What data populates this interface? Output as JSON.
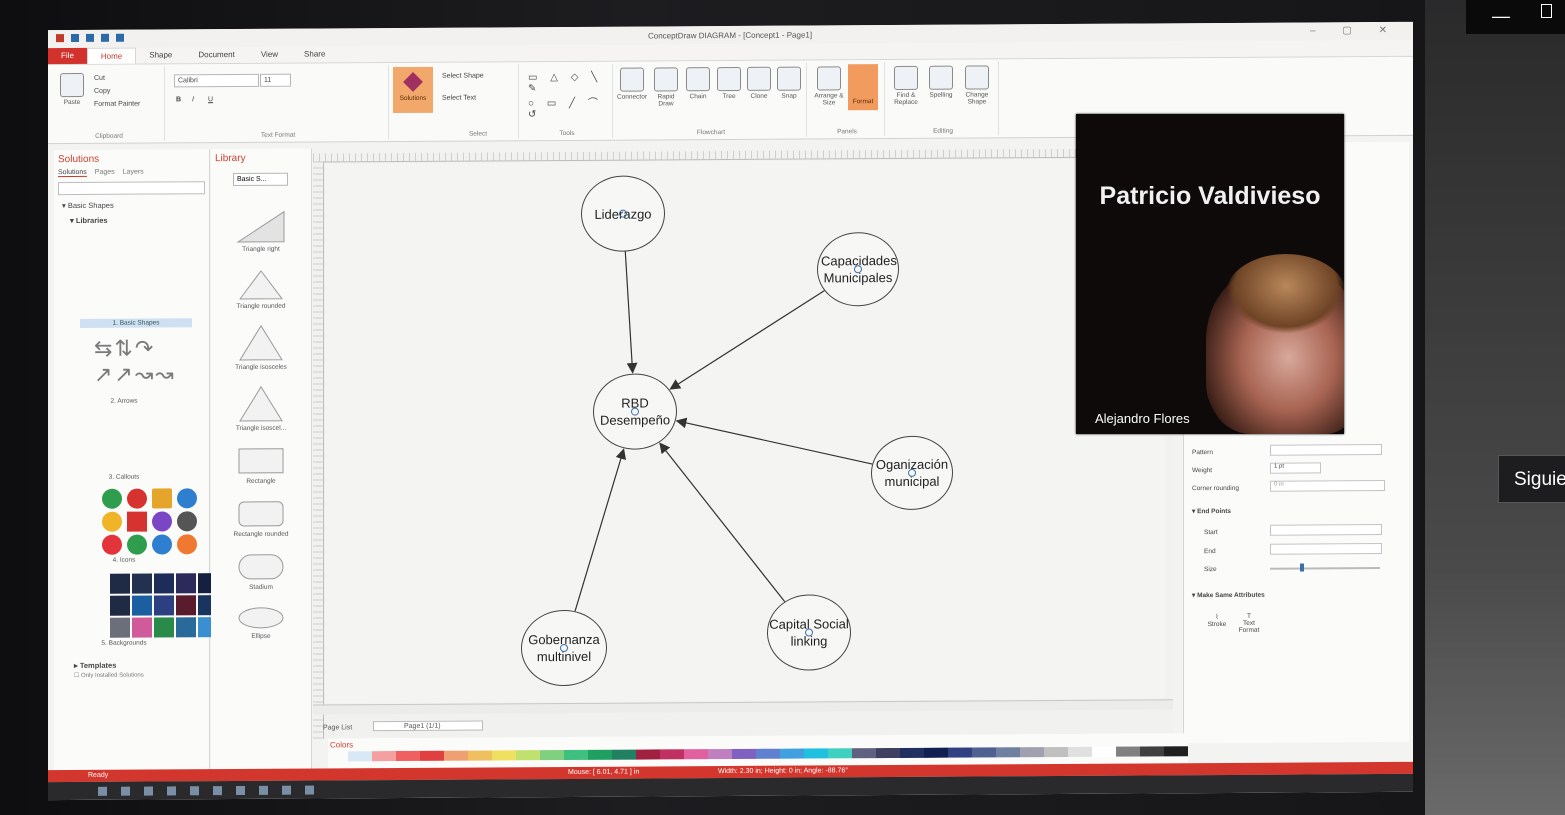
{
  "app": {
    "title": "ConceptDraw DIAGRAM - [Concept1 - Page1]"
  },
  "ribbon_tabs": [
    "File",
    "Home",
    "Shape",
    "Document",
    "View",
    "Share"
  ],
  "ribbon": {
    "clipboard": {
      "paste": "Paste",
      "cut": "Cut",
      "copy": "Copy",
      "format_painter": "Format Painter",
      "label": "Clipboard"
    },
    "text_format": {
      "font": "Calibri",
      "size": "11",
      "label": "Text Format"
    },
    "solutions": "Solutions",
    "select": {
      "select_shape": "Select Shape",
      "select_text": "Select Text",
      "label": "Select"
    },
    "tools_label": "Tools",
    "flowchart": {
      "connector": "Connector",
      "rapid_draw": "Rapid Draw",
      "chain": "Chain",
      "tree": "Tree",
      "clone": "Clone",
      "snap": "Snap",
      "label": "Flowchart"
    },
    "panels": {
      "arrange": "Arrange & Size",
      "format": "Format",
      "label": "Panels"
    },
    "editing": {
      "find": "Find & Replace",
      "spelling": "Spelling",
      "change_shape": "Change Shape",
      "label": "Editing"
    }
  },
  "solutions_panel": {
    "title": "Solutions",
    "tabs": [
      "Solutions",
      "Pages",
      "Layers"
    ],
    "tree": [
      "Basic Shapes",
      "Libraries"
    ],
    "libraries": [
      "1. Basic Shapes",
      "2. Arrows",
      "3. Callouts",
      "4. Icons",
      "5. Backgrounds"
    ],
    "templates": "Templates",
    "only_installed": "Only Installed Solutions"
  },
  "library_panel": {
    "title": "Library",
    "selector": "Basic S...",
    "shapes": [
      "Triangle right",
      "Triangle rounded",
      "Triangle isosceles",
      "Triangle isoscel...",
      "Rectangle",
      "Rectangle rounded",
      "Stadium",
      "Ellipse"
    ]
  },
  "diagram": {
    "nodes": [
      {
        "id": "liderazgo",
        "text": "Liderazgo"
      },
      {
        "id": "capacidades",
        "text": "Capacidades Municipales"
      },
      {
        "id": "rbd",
        "text": "RBD Desempeño"
      },
      {
        "id": "organizacion",
        "text": "Oganización municipal"
      },
      {
        "id": "gobernanza",
        "text": "Gobernanza multinivel"
      },
      {
        "id": "capital",
        "text": "Capital Social linking"
      }
    ],
    "edges": [
      {
        "from": "liderazgo",
        "to": "rbd"
      },
      {
        "from": "capacidades",
        "to": "rbd"
      },
      {
        "from": "organizacion",
        "to": "rbd"
      },
      {
        "from": "gobernanza",
        "to": "rbd"
      },
      {
        "from": "capital",
        "to": "rbd"
      }
    ]
  },
  "page_list": {
    "label": "Page List",
    "current": "Page1 (1/1)"
  },
  "colors_label": "Colors",
  "status": {
    "ready": "Ready",
    "mouse": "Mouse: [ 6.01, 4.71 ] in",
    "size": "Width: 2.30 in; Height: 0 in; Angle: -88.76°"
  },
  "properties_panel": {
    "pattern": "Pattern",
    "weight": "Weight",
    "weight_value": "1 pt",
    "corner_rounding": "Corner rounding",
    "corner_rounding_value": "0 in",
    "end_points": "End Points",
    "start": "Start",
    "end": "End",
    "size": "Size",
    "make_same": "Make Same Attributes",
    "stroke": "Stroke",
    "text_format": "Text Format"
  },
  "video_overlay": {
    "title": "Patricio Valdivieso",
    "participant": "Alejandro Flores"
  },
  "tooltip": "Siguie",
  "accent": "#d3312c"
}
